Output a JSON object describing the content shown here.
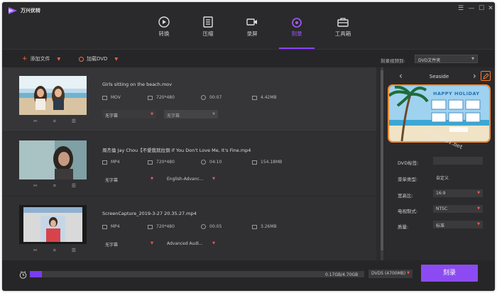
{
  "app": {
    "name": "万兴优转"
  },
  "window_controls": [
    "☰",
    "—",
    "☐",
    "✕"
  ],
  "tabs": [
    {
      "label": "转换",
      "icon": "convert-icon",
      "active": false
    },
    {
      "label": "压缩",
      "icon": "compress-icon",
      "active": false
    },
    {
      "label": "录屏",
      "icon": "record-icon",
      "active": false
    },
    {
      "label": "刻录",
      "icon": "burn-disc-icon",
      "active": true
    },
    {
      "label": "工具箱",
      "icon": "toolbox-icon",
      "active": false
    }
  ],
  "toolbar": {
    "add_file": "添加文件",
    "load_dvd": "加载DVD",
    "burn_to_label": "刻录视频到:",
    "burn_to_value": "DVD文件夹"
  },
  "files": [
    {
      "name": "Girls sitting on the beach.mov",
      "format": "MOV",
      "resolution": "720*480",
      "duration": "00:07",
      "size": "4.42MB",
      "subtitle": "无字幕",
      "audio": "无字幕"
    },
    {
      "name": "周杰倫 Jay Chou【不愛我就拉倒 If You Don't Love Me, It's Fine.mp4",
      "format": "MP4",
      "resolution": "720*480",
      "duration": "04:10",
      "size": "154.18MB",
      "subtitle": "无字幕",
      "audio": "English-Advanc..."
    },
    {
      "name": "ScreenCapture_2019-3-27 20.35.27.mp4",
      "format": "MP4",
      "resolution": "720*480",
      "duration": "00:05",
      "size": "3.26MB",
      "subtitle": "无字幕",
      "audio": "Advanced Audi..."
    }
  ],
  "template": {
    "name": "Seaside",
    "preview_title": "HAPPY HOLIDAY",
    "watermark": "www.jb51.net"
  },
  "settings": [
    {
      "label": "DVD标签:",
      "value": "",
      "dropdown": false
    },
    {
      "label": "菜单类型:",
      "value": "自定义",
      "dropdown": false
    },
    {
      "label": "宽高比:",
      "value": "16:9",
      "dropdown": true
    },
    {
      "label": "电视制式:",
      "value": "NTSC",
      "dropdown": true
    },
    {
      "label": "质量:",
      "value": "标准",
      "dropdown": true
    }
  ],
  "bottom": {
    "progress_text": "0.17GB/4.70GB",
    "progress_fraction": 0.036,
    "disc_type": "DVD5 (4700MB)",
    "burn_button": "刻录"
  },
  "colors": {
    "accent": "#8c4bf2",
    "highlight": "#ff8a2c",
    "icon_accent": "#ff6a3c"
  }
}
